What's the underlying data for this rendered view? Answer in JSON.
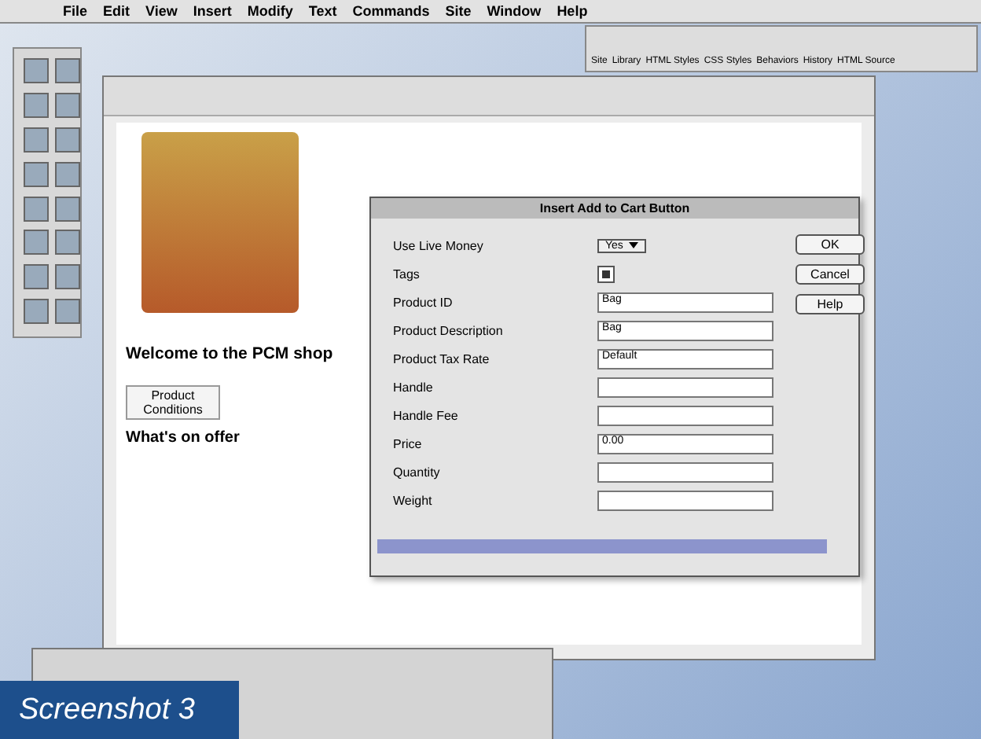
{
  "menu_bar": {
    "items": [
      "File",
      "Edit",
      "View",
      "Insert",
      "Modify",
      "Text",
      "Commands",
      "Site",
      "Window",
      "Help"
    ]
  },
  "launcher": {
    "items": [
      "Site",
      "Library",
      "HTML Styles",
      "CSS Styles",
      "Behaviors",
      "History",
      "HTML Source"
    ]
  },
  "document": {
    "heading": "Welcome to the PCM shop",
    "button": "Product Conditions",
    "subheading": "What's on offer"
  },
  "dialog": {
    "title": "Insert Add to Cart Button",
    "fields": [
      {
        "kind": "select",
        "label": "Use Live Money",
        "value": "Yes"
      },
      {
        "kind": "checkbox",
        "label": "Tags",
        "checked": true
      },
      {
        "kind": "text",
        "label": "Product ID",
        "value": "Bag"
      },
      {
        "kind": "text",
        "label": "Product Description",
        "value": "Bag"
      },
      {
        "kind": "text",
        "label": "Product Tax Rate",
        "value": "Default"
      },
      {
        "kind": "text",
        "label": "Handle"
      },
      {
        "kind": "text",
        "label": "Handle Fee"
      },
      {
        "kind": "text",
        "label": "Price",
        "value": "0.00"
      },
      {
        "kind": "text",
        "label": "Quantity"
      },
      {
        "kind": "text",
        "label": "Weight"
      }
    ],
    "buttons": [
      "OK",
      "Cancel",
      "Help"
    ]
  },
  "caption": "Screenshot 3"
}
